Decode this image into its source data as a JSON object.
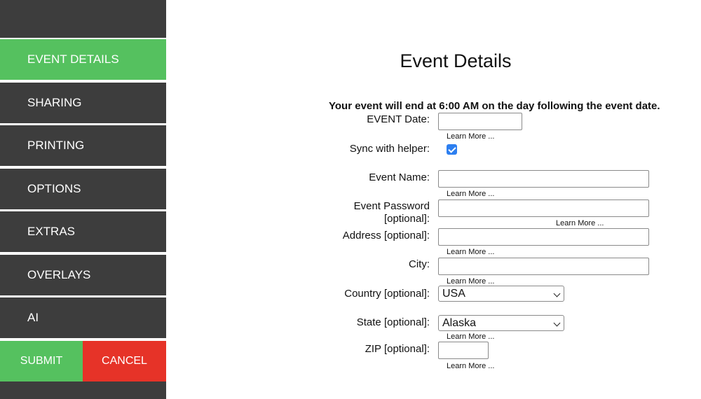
{
  "sidebar": {
    "items": [
      {
        "label": "EVENT DETAILS",
        "active": true
      },
      {
        "label": "SHARING"
      },
      {
        "label": "PRINTING"
      },
      {
        "label": "OPTIONS"
      },
      {
        "label": "EXTRAS"
      },
      {
        "label": "OVERLAYS"
      },
      {
        "label": "AI"
      }
    ],
    "submit_label": "SUBMIT",
    "cancel_label": "CANCEL"
  },
  "main": {
    "title": "Event Details",
    "notice": "Your event will end at 6:00 AM on the day following the event date.",
    "learn_more": "Learn More ...",
    "fields": {
      "event_date_label": "EVENT Date:",
      "sync_label": "Sync with helper:",
      "sync_checked": true,
      "event_name_label": "Event Name:",
      "event_password_label_1": "Event Password",
      "event_password_label_2": "[optional]:",
      "address_label": "Address [optional]:",
      "city_label": "City:",
      "country_label": "Country [optional]:",
      "country_value": "USA",
      "state_label": "State [optional]:",
      "state_value": "Alaska",
      "zip_label": "ZIP [optional]:"
    }
  },
  "colors": {
    "accent_green": "#55c15f",
    "cancel_red": "#e63328",
    "sidebar_dark": "#3d3d3d",
    "checkbox_blue": "#2d7ff0"
  }
}
